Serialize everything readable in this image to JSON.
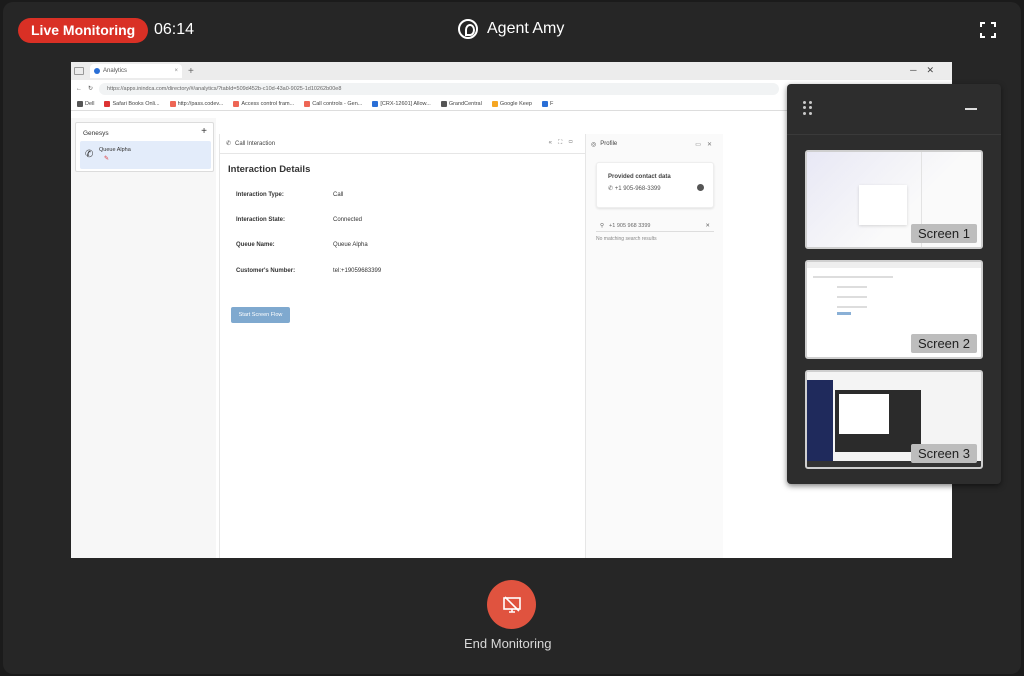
{
  "header": {
    "live_badge": "Live Monitoring",
    "timer": "06:14",
    "agent_name": "Agent Amy"
  },
  "browser": {
    "tab_title": "Analytics",
    "url": "https://apps.inindca.com/directory/#/analytics/?tabId=509d452b-c10d-43a0-9025-1d10262b00e8",
    "bookmarks": [
      "Dell",
      "Safari Books Onli...",
      "http://pass.codev...",
      "Access control fram...",
      "Call controls - Gen...",
      "[CRX-12601] Allow...",
      "GrandCentral",
      "Google Keep",
      "F"
    ]
  },
  "genesys": {
    "title": "Genesys",
    "queue_label": "Queue Alpha"
  },
  "call_panel": {
    "header": "Call Interaction",
    "title": "Interaction Details",
    "rows": [
      {
        "key": "Interaction Type:",
        "value": "Call"
      },
      {
        "key": "Interaction State:",
        "value": "Connected"
      },
      {
        "key": "Queue Name:",
        "value": "Queue Alpha"
      },
      {
        "key": "Customer's Number:",
        "value": "tel:+19059683399"
      }
    ],
    "button": "Start Screen Flow"
  },
  "profile_panel": {
    "header": "Profile",
    "card_title": "Provided contact data",
    "phone": "+1 905-968-3399",
    "search_value": "+1 905 968 3399",
    "no_results": "No matching search results"
  },
  "screens": [
    {
      "label": "Screen 1"
    },
    {
      "label": "Screen 2"
    },
    {
      "label": "Screen 3"
    }
  ],
  "footer": {
    "end_label": "End Monitoring"
  },
  "colors": {
    "live_red": "#d93025",
    "end_button": "#e0533f",
    "background": "#262626"
  }
}
